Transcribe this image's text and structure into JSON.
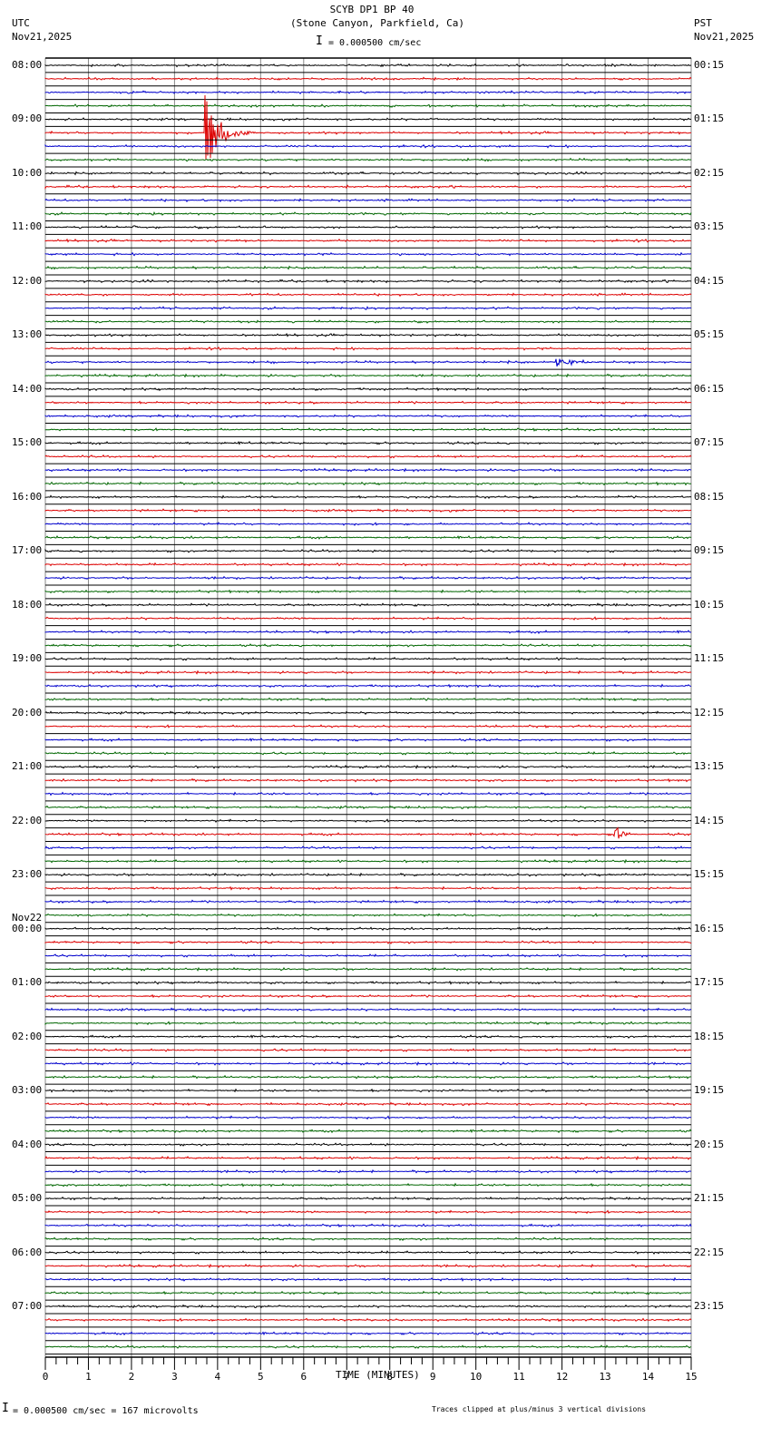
{
  "header": {
    "title": "SCYB DP1 BP 40",
    "subtitle": "(Stone Canyon, Parkfield, Ca)",
    "left_tz": "UTC",
    "left_date": "Nov21,2025",
    "right_tz": "PST",
    "right_date": "Nov21,2025",
    "scale": "= 0.000500 cm/sec"
  },
  "footer": {
    "scale_note": "= 0.000500 cm/sec =     167 microvolts",
    "clip_note": "Traces clipped at plus/minus 3 vertical divisions"
  },
  "chart_data": {
    "type": "line",
    "title": "SCYB DP1 BP 40",
    "xlabel": "TIME (MINUTES)",
    "xlim": [
      0,
      15
    ],
    "x_ticks": [
      "0",
      "1",
      "2",
      "3",
      "4",
      "5",
      "6",
      "7",
      "8",
      "9",
      "10",
      "11",
      "12",
      "13",
      "14",
      "15"
    ],
    "traces_per_hour": 4,
    "trace_count": 96,
    "trace_colors": [
      "#000000",
      "#dd0000",
      "#0000cc",
      "#006600"
    ],
    "left_labels": [
      "08:00",
      "09:00",
      "10:00",
      "11:00",
      "12:00",
      "13:00",
      "14:00",
      "15:00",
      "16:00",
      "17:00",
      "18:00",
      "19:00",
      "20:00",
      "21:00",
      "22:00",
      "23:00",
      "00:00",
      "01:00",
      "02:00",
      "03:00",
      "04:00",
      "05:00",
      "06:00",
      "07:00"
    ],
    "day_change_label": "Nov22",
    "right_labels": [
      "00:15",
      "01:15",
      "02:15",
      "03:15",
      "04:15",
      "05:15",
      "06:15",
      "07:15",
      "08:15",
      "09:15",
      "10:15",
      "11:15",
      "12:15",
      "13:15",
      "14:15",
      "15:15",
      "16:15",
      "17:15",
      "18:15",
      "19:15",
      "20:15",
      "21:15",
      "22:15",
      "23:15"
    ],
    "events": [
      {
        "trace": 5,
        "minute": 3.75,
        "amplitude": 3,
        "duration": 1.2
      },
      {
        "trace": 12,
        "minute": 2.1,
        "amplitude": 0.3,
        "duration": 0.3
      },
      {
        "trace": 22,
        "minute": 11.9,
        "amplitude": 0.35,
        "duration": 1.5
      },
      {
        "trace": 57,
        "minute": 13.25,
        "amplitude": 1.0,
        "duration": 0.5
      }
    ]
  }
}
